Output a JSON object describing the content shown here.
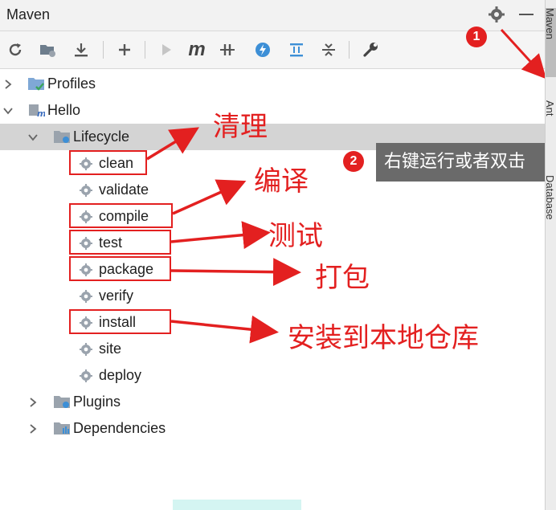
{
  "panel": {
    "title": "Maven"
  },
  "toolbar": {
    "icons": [
      "refresh-icon",
      "generate-sources-icon",
      "download-icon",
      "add-icon",
      "run-icon",
      "maven-goal-icon",
      "toggle-offline-icon",
      "skip-tests-icon",
      "show-dependencies-icon",
      "collapse-all-icon",
      "settings-wrench-icon"
    ],
    "m_label": "m"
  },
  "tree": {
    "profiles": "Profiles",
    "project": "Hello",
    "lifecycle": "Lifecycle",
    "goals": [
      "clean",
      "validate",
      "compile",
      "test",
      "package",
      "verify",
      "install",
      "site",
      "deploy"
    ],
    "plugins": "Plugins",
    "dependencies": "Dependencies"
  },
  "annotations": {
    "clean": "清理",
    "compile": "编译",
    "test": "测试",
    "package": "打包",
    "install": "安装到本地仓库",
    "tooltip": "右键运行或者双击",
    "badge1": "1",
    "badge2": "2"
  },
  "side_tabs": {
    "maven": "Maven",
    "ant": "Ant",
    "database": "Database"
  },
  "colors": {
    "annotation_red": "#e32020",
    "selection": "#d4d4d4",
    "folder_blue": "#7fa8d6",
    "gear_gray": "#9aa3ad"
  }
}
